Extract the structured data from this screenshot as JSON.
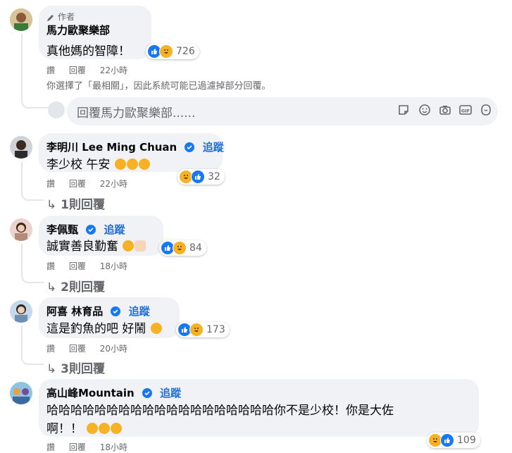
{
  "comments": [
    {
      "author_tag": "作者",
      "name": "馬力歐聚樂部",
      "text": "真他媽的智障！",
      "reaction_count": "726",
      "actions": [
        "讚",
        "回覆"
      ],
      "time": "22小時",
      "filter_note": "你選擇了「最相關」，因此系統可能已過濾掉部分回覆。",
      "reply_placeholder": "回覆馬力歐聚樂部......"
    },
    {
      "name": "李明川 Lee Ming Chuan",
      "follow": "追蹤",
      "text": "李少校 午安",
      "reaction_count": "32",
      "actions": [
        "讚",
        "回覆"
      ],
      "time": "22小時",
      "replies": "1則回覆"
    },
    {
      "name": "李佩甄",
      "follow": "追蹤",
      "text": "誠實善良勤奮",
      "reaction_count": "84",
      "actions": [
        "讚",
        "回覆"
      ],
      "time": "18小時",
      "replies": "2則回覆"
    },
    {
      "name": "阿喜 林育品",
      "follow": "追蹤",
      "text": "這是釣魚的吧 好鬧",
      "reaction_count": "173",
      "actions": [
        "讚",
        "回覆"
      ],
      "time": "20小時",
      "replies": "3則回覆"
    },
    {
      "name": "高山峰Mountain",
      "follow": "追蹤",
      "text_line1": "哈哈哈哈哈哈哈哈哈哈哈哈哈哈哈哈哈哈哈你不是少校！你是大佐",
      "text_line2": "啊！！",
      "reaction_count": "109",
      "actions": [
        "讚",
        "回覆"
      ],
      "time": "18小時"
    }
  ],
  "icons": {
    "pencil": "pencil-icon",
    "verified": "verified-badge-icon",
    "like": "like-reaction-icon",
    "haha": "haha-reaction-icon",
    "reply_arrow": "reply-arrow-icon",
    "sticker": "sticker-icon",
    "emoji": "emoji-icon",
    "camera": "camera-icon",
    "gif": "gif-icon",
    "avatar_sticker": "avatar-sticker-icon"
  },
  "colors": {
    "link_blue": "#216fdb",
    "bubble_bg": "#f0f2f5",
    "secondary_text": "#65676b",
    "like_blue": "#1877f2",
    "haha_yellow": "#f7b125"
  }
}
